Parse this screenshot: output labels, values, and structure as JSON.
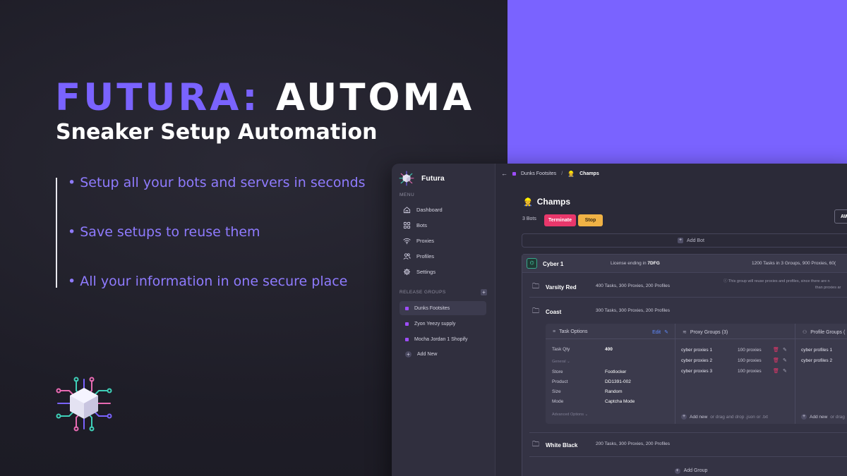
{
  "hero": {
    "brand": "FUTURA:",
    "title_rest": "AUTOMA",
    "subtitle": "Sneaker Setup Automation",
    "features": [
      "• Setup all your bots and servers in seconds",
      "• Save setups to reuse them",
      "• All your information in one secure place"
    ]
  },
  "colors": {
    "accent": "#7a63ff",
    "terminate": "#e8376b",
    "stop": "#f0b245",
    "group_square": "#9e4dff"
  },
  "app": {
    "brand_name": "Futura",
    "menu_label": "MENU",
    "menu_items": [
      {
        "label": "Dashboard",
        "icon": "home-icon"
      },
      {
        "label": "Bots",
        "icon": "grid-icon"
      },
      {
        "label": "Proxies",
        "icon": "wifi-icon"
      },
      {
        "label": "Profiles",
        "icon": "users-icon"
      },
      {
        "label": "Settings",
        "icon": "gear-icon"
      }
    ],
    "release_groups_label": "RELEASE GROUPS",
    "release_groups": [
      "Dunks Footsites",
      "Zyon Yeezy supply",
      "Mocha Jordan 1 Shopify"
    ],
    "add_new": "Add New",
    "breadcrumb": {
      "parent": "Dunks Footsites",
      "separator": "/",
      "current": "Champs"
    },
    "page_title": "Champs",
    "bots_count": "3 Bots",
    "terminate": "Terminate",
    "stop": "Stop",
    "right_button": "AW",
    "add_bot": "Add Bot",
    "bot": {
      "name": "Cyber 1",
      "license_prefix": "License ending in",
      "license_code": "7DFG",
      "stats": "1200 Tasks in 3 Groups, 900 Proxies, 60("
    },
    "groups": [
      {
        "name": "Varsity Red",
        "stats": "400 Tasks, 300 Proxies, 200 Profiles"
      },
      {
        "name": "Coast",
        "stats": "300 Tasks, 300 Proxies, 200 Profiles"
      },
      {
        "name": "White Black",
        "stats": "200 Tasks, 300 Proxies, 200 Profiles"
      }
    ],
    "group_note_line1": "ⓘ This group will reuse proxies and profiles, since there are n",
    "group_note_line2": "than proxies ar",
    "task_options": {
      "title": "Task Options",
      "edit": "Edit",
      "qty_label": "Task Qty",
      "qty_value": "400",
      "general_label": "General ⌄",
      "fields": [
        {
          "key": "Store",
          "value": "Footlocker"
        },
        {
          "key": "Product",
          "value": "DD1391-002"
        },
        {
          "key": "Size",
          "value": "Random"
        },
        {
          "key": "Mode",
          "value": "Captcha Mode"
        }
      ],
      "advanced_label": "Advanced Options ⌄"
    },
    "proxy_groups": {
      "title": "Proxy Groups (3)",
      "items": [
        {
          "name": "cyber proxies 1",
          "count": "100 proxies"
        },
        {
          "name": "cyber proxies 2",
          "count": "100 proxies"
        },
        {
          "name": "cyber proxies 3",
          "count": "100 proxies"
        }
      ],
      "add_new": "Add new",
      "add_hint": "or drag and drop .json or .txt"
    },
    "profile_groups": {
      "title": "Profile Groups (",
      "items": [
        "cyber profiles 1",
        "cyber profiles 2"
      ],
      "add_new": "Add new",
      "add_hint": "or drag"
    },
    "add_group": "Add Group"
  }
}
